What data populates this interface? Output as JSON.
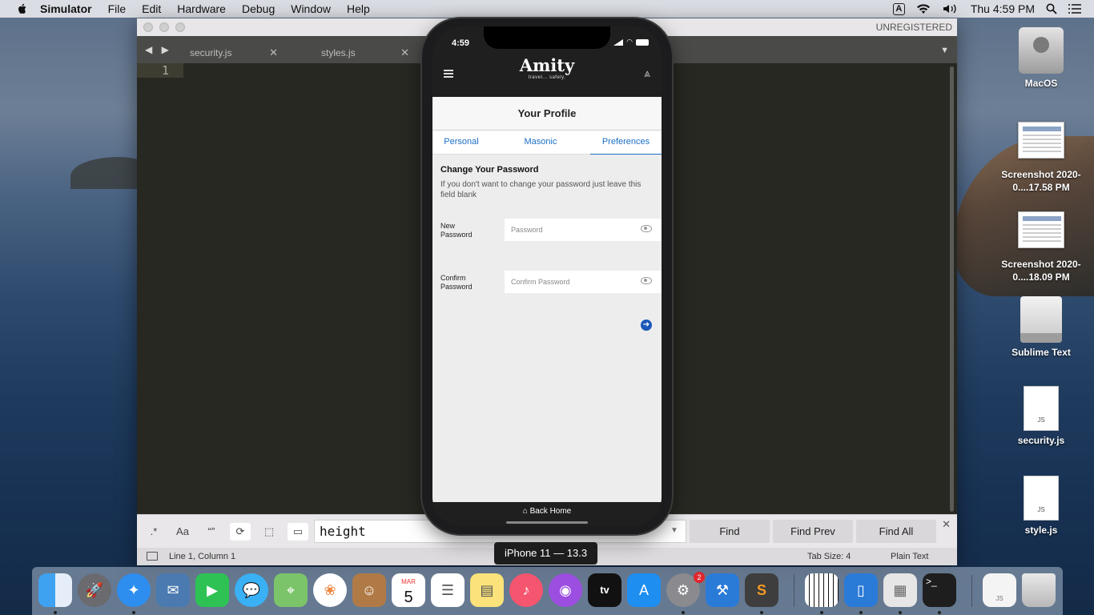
{
  "menubar": {
    "app_name": "Simulator",
    "items": [
      "File",
      "Edit",
      "Hardware",
      "Debug",
      "Window",
      "Help"
    ],
    "input_indicator": "A",
    "clock": "Thu 4:59 PM"
  },
  "sublime": {
    "unregistered": "UNREGISTERED",
    "tabs": [
      {
        "label": "security.js"
      },
      {
        "label": "styles.js"
      }
    ],
    "line_number": "1",
    "find": {
      "regex_label": ".*",
      "case_label": "Aa",
      "word_label": "“”",
      "query": "height",
      "find_label": "Find",
      "find_prev_label": "Find Prev",
      "find_all_label": "Find All"
    },
    "status": {
      "position": "Line 1, Column 1",
      "tab_size": "Tab Size: 4",
      "syntax": "Plain Text"
    }
  },
  "phone": {
    "time": "4:59",
    "app_logo": "Amity",
    "app_tagline": "travel... safely.",
    "page_title": "Your Profile",
    "tabs": [
      {
        "label": "Personal"
      },
      {
        "label": "Masonic"
      },
      {
        "label": "Preferences",
        "active": true
      }
    ],
    "section_heading": "Change Your Password",
    "section_help": "If you don't want to change your password just leave this field blank",
    "new_password_label": "New Password",
    "new_password_placeholder": "Password",
    "confirm_password_label": "Confirm Password",
    "confirm_password_placeholder": "Confirm Password",
    "back_home_label": "Back Home"
  },
  "simulator_device_label": "iPhone 11 — 13.3",
  "desktop_icons": [
    {
      "label": "MacOS",
      "kind": "hard-drive"
    },
    {
      "label": "Screenshot 2020-0....17.58 PM",
      "kind": "screenshot"
    },
    {
      "label": "Screenshot 2020-0....18.09 PM",
      "kind": "screenshot"
    },
    {
      "label": "Sublime Text",
      "kind": "drive"
    },
    {
      "label": "security.js",
      "kind": "js-file"
    },
    {
      "label": "style.js",
      "kind": "js-file"
    }
  ],
  "dock": {
    "calendar_month": "MAR",
    "calendar_day": "5",
    "apple_tv_label": "tv",
    "sys_prefs_badge": "2",
    "apps": [
      "Finder",
      "Launchpad",
      "Safari",
      "Mail",
      "FaceTime",
      "Messages",
      "Maps",
      "Photos",
      "Contacts",
      "Calendar",
      "Reminders",
      "Notes",
      "Music",
      "Podcasts",
      "TV",
      "App Store",
      "System Preferences",
      "Xcode",
      "Sublime Text",
      "Piano",
      "Simulator",
      "Preview",
      "Terminal",
      "Document",
      "Trash"
    ]
  },
  "colors": {
    "editor_bg": "#272822",
    "tab_accent": "#1a6fc4",
    "next_button": "#1a58b8"
  }
}
